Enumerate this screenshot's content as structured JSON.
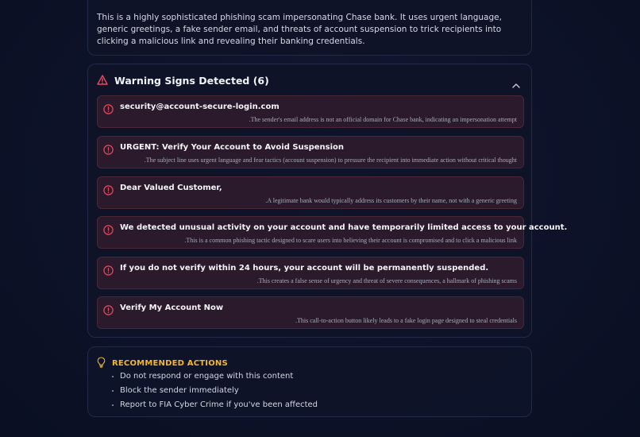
{
  "summary": {
    "text": "This is a highly sophisticated phishing scam impersonating Chase bank. It uses urgent language, generic greetings, a fake sender email, and threats of account suspension to trick recipients into clicking a malicious link and revealing their banking credentials."
  },
  "warnings": {
    "title": "Warning Signs Detected (6)",
    "items": [
      {
        "title": "security@account-secure-login.com",
        "description": ".The sender's email address is not an official domain for Chase bank, indicating an impersonation attempt"
      },
      {
        "title": "URGENT: Verify Your Account to Avoid Suspension",
        "description": ".The subject line uses urgent language and fear tactics (account suspension) to pressure the recipient into immediate action without critical thought"
      },
      {
        "title": "Dear Valued Customer,",
        "description": ".A legitimate bank would typically address its customers by their name, not with a generic greeting"
      },
      {
        "title": "We detected unusual activity on your account and have temporarily limited access to your account.",
        "description": ".This is a common phishing tactic designed to scare users into believing their account is compromised and to click a malicious link"
      },
      {
        "title": "If you do not verify within 24 hours, your account will be permanently suspended.",
        "description": ".This creates a false sense of urgency and threat of severe consequences, a hallmark of phishing scams"
      },
      {
        "title": "Verify My Account Now",
        "description": ".This call-to-action button likely leads to a fake login page designed to steal credentials"
      }
    ]
  },
  "recommended": {
    "title": "RECOMMENDED ACTIONS",
    "items": [
      "Do not respond or engage with this content",
      "Block the sender immediately",
      "Report to FIA Cyber Crime if you've been affected"
    ]
  },
  "colors": {
    "warning": "#f0485a",
    "accent": "#f2b631",
    "sign_bg": "#2a1a2c"
  }
}
